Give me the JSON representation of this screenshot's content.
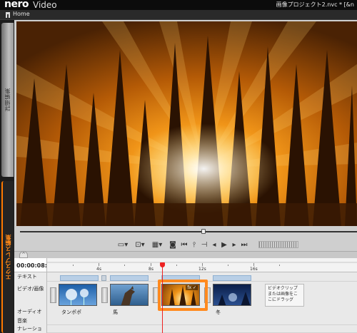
{
  "app": {
    "logo": "nero",
    "logo_sub": "Video",
    "project_title": "画像プロジェクト2.nvc * [&n"
  },
  "nav": {
    "home_label": "Home",
    "home_icon": "home-icon"
  },
  "sidebar": {
    "advanced_tab": "詳細編集",
    "express_tab": "エクスプレス編集"
  },
  "preview": {
    "scene": "sunlight-through-trees",
    "seek_position_fraction": 0.54
  },
  "toolbar": {
    "buttons": [
      {
        "name": "display-mode-button",
        "label": "▭▾"
      },
      {
        "name": "fit-button",
        "label": "⊡▾"
      },
      {
        "name": "layout-button",
        "label": "▦▾"
      },
      {
        "name": "snapshot-button",
        "label": "◙"
      },
      {
        "name": "start-button",
        "label": "⏮"
      },
      {
        "name": "split-button",
        "label": "⫯"
      },
      {
        "name": "mark-in-button",
        "label": "⊣"
      },
      {
        "name": "prev-frame-button",
        "label": "◂"
      },
      {
        "name": "play-button",
        "label": "▶"
      },
      {
        "name": "next-frame-button",
        "label": "▸"
      },
      {
        "name": "end-button",
        "label": "⏭"
      },
      {
        "name": "mark-out-button",
        "label": "⊢"
      }
    ]
  },
  "timeline": {
    "timecode": "00:00:08:0",
    "collapse_label": "^",
    "ruler_labels": [
      "4s",
      "8s",
      "12s",
      "16s"
    ],
    "tracks": {
      "text": "テキスト",
      "video": "ビデオ/画像",
      "audio": "オーディオ",
      "music": "音楽",
      "narration": "ナレーション"
    },
    "clips": [
      {
        "name": "タンポポ",
        "thumb": "dandelion"
      },
      {
        "name": "馬",
        "thumb": "horse"
      },
      {
        "name": "",
        "thumb": "sunlight",
        "badge": "fx ✓"
      },
      {
        "name": "冬",
        "thumb": "winter"
      }
    ],
    "drop_hint": "ビデオクリップまたは画像をここにドラッグ"
  },
  "colors": {
    "accent": "#ff8a1f",
    "playhead": "#e22222",
    "title_slot": "#b9cfe6"
  }
}
